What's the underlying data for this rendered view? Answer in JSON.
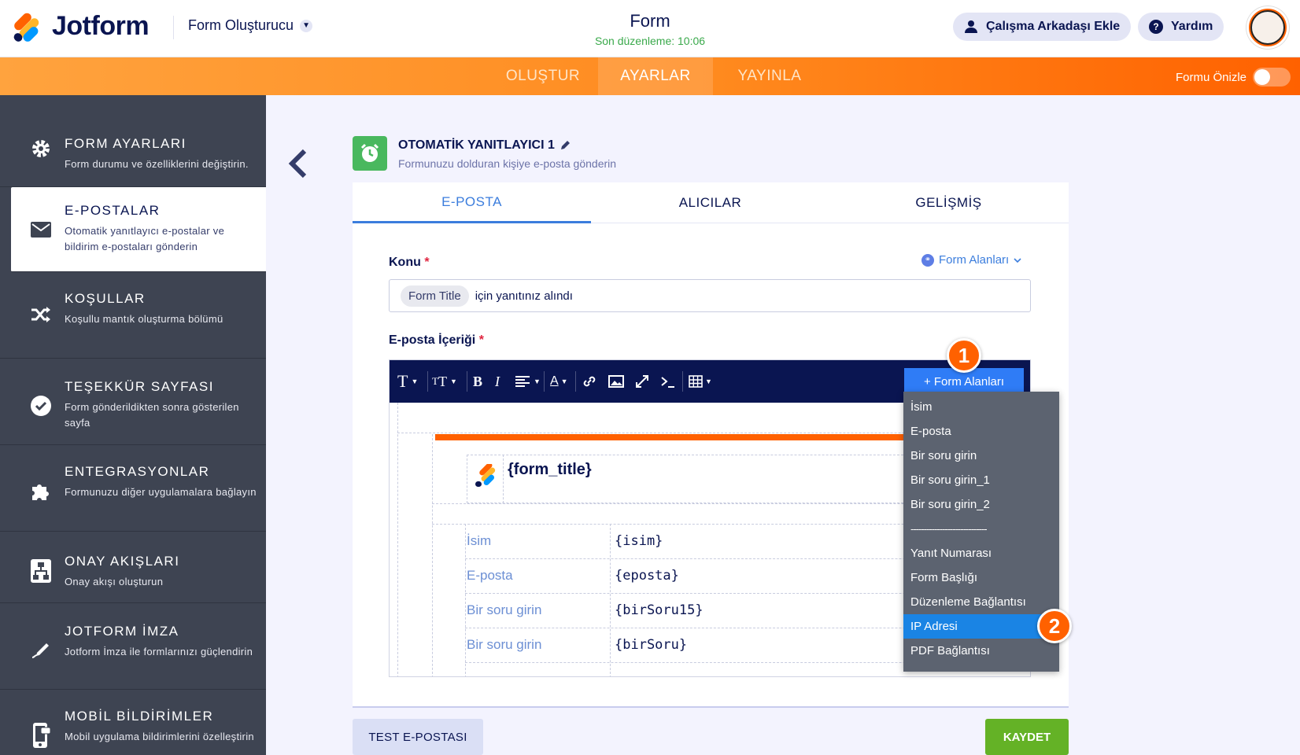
{
  "header": {
    "logo_text": "Jotform",
    "form_builder_label": "Form Oluşturucu",
    "title": "Form",
    "last_edit": "Son düzenleme: 10:06",
    "invite_label": "Çalışma Arkadaşı Ekle",
    "help_label": "Yardım"
  },
  "nav": {
    "tabs": [
      "OLUŞTUR",
      "AYARLAR",
      "YAYINLA"
    ],
    "active_tab": "AYARLAR",
    "preview_label": "Formu Önizle"
  },
  "sidebar": {
    "items": [
      {
        "title": "FORM AYARLARI",
        "desc": "Form durumu ve özelliklerini değiştirin.",
        "icon": "gear-icon"
      },
      {
        "title": "E-POSTALAR",
        "desc": "Otomatik yanıtlayıcı e-postalar ve bildirim e-postaları gönderin",
        "icon": "envelope-icon"
      },
      {
        "title": "KOŞULLAR",
        "desc": "Koşullu mantık oluşturma bölümü",
        "icon": "shuffle-icon"
      },
      {
        "title": "TEŞEKKÜR SAYFASI",
        "desc": "Form gönderildikten sonra gösterilen sayfa",
        "icon": "check-circle-icon"
      },
      {
        "title": "ENTEGRASYONLAR",
        "desc": "Formunuzu diğer uygulamalara bağlayın",
        "icon": "puzzle-icon"
      },
      {
        "title": "ONAY AKIŞLARI",
        "desc": "Onay akışı oluşturun",
        "icon": "flow-icon"
      },
      {
        "title": "JOTFORM İMZA",
        "desc": "Jotform İmza ile formlarınızı güçlendirin",
        "icon": "pen-icon"
      },
      {
        "title": "MOBİL BİLDİRİMLER",
        "desc": "Mobil uygulama bildirimlerini özelleştirin",
        "icon": "mobile-icon"
      }
    ],
    "active_index": 1
  },
  "panel": {
    "title": "OTOMATİK YANITLAYICI 1",
    "subtitle": "Formunuzu dolduran kişiye e-posta gönderin",
    "tabs": [
      "E-POSTA",
      "ALICILAR",
      "GELİŞMİŞ"
    ],
    "active_tab": "E-POSTA"
  },
  "subject": {
    "label": "Konu",
    "required_mark": "*",
    "chip": "Form Title",
    "value": "için yanıtınız alındı",
    "form_fields_link": "Form Alanları"
  },
  "content": {
    "label": "E-posta İçeriği",
    "required_mark": "*",
    "form_fields_button": "+ Form Alanları",
    "form_title_placeholder": "{form_title}",
    "rows": [
      {
        "label": "İsim",
        "value": "{isim}"
      },
      {
        "label": "E-posta",
        "value": "{eposta}"
      },
      {
        "label": "Bir soru girin",
        "value": "{birSoru15}"
      },
      {
        "label": "Bir soru girin",
        "value": "{birSoru}"
      }
    ]
  },
  "dropdown": {
    "items": [
      "İsim",
      "E-posta",
      "Bir soru girin",
      "Bir soru girin_1",
      "Bir soru girin_2",
      "-----------------------------",
      "Yanıt Numarası",
      "Form Başlığı",
      "Düzenleme Bağlantısı",
      "IP Adresi",
      "PDF Bağlantısı"
    ],
    "selected": "IP Adresi"
  },
  "badges": [
    "1",
    "2"
  ],
  "footer": {
    "test_label": "TEST E-POSTASI",
    "save_label": "KAYDET"
  },
  "colors": {
    "brand_orange": "#ff6100",
    "accent_blue": "#3b7ddd",
    "save_green": "#64b226",
    "sidebar_bg": "#3e4452",
    "toolbar_navy": "#0a1551"
  }
}
